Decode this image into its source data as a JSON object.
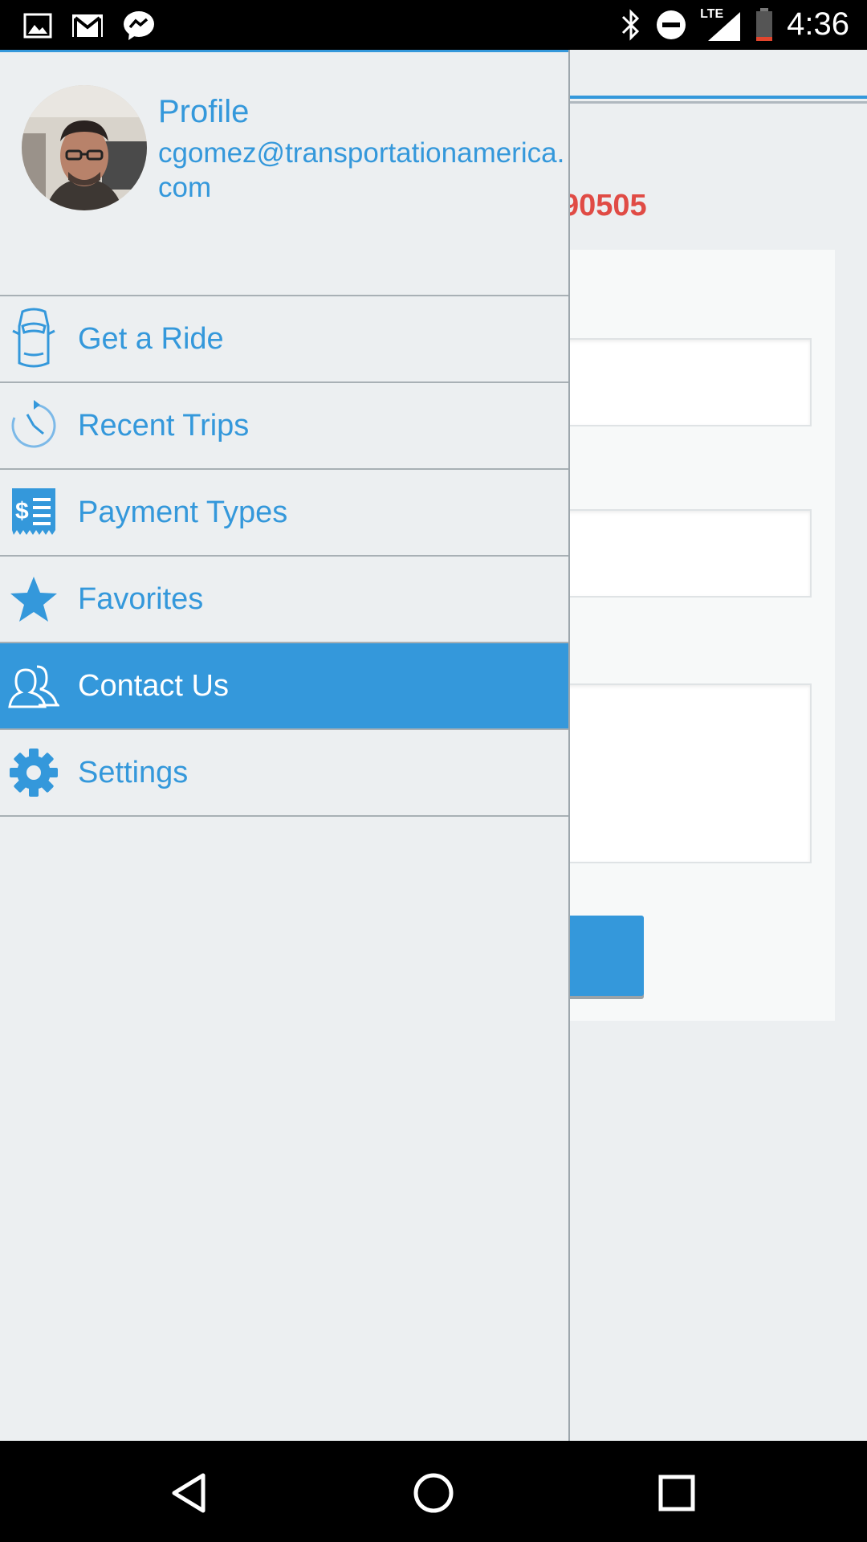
{
  "status_bar": {
    "time": "4:36",
    "network": "LTE",
    "left_icons": [
      "image-icon",
      "gmail-icon",
      "messenger-icon"
    ],
    "right_icons": [
      "bluetooth-icon",
      "do-not-disturb-icon",
      "signal-icon",
      "battery-icon"
    ]
  },
  "background_screen": {
    "code_fragment": "90505",
    "colors": {
      "accent": "#3498db",
      "code": "#e04b45"
    }
  },
  "drawer": {
    "profile": {
      "title": "Profile",
      "email": "cgomez@transportationamerica.com"
    },
    "items": [
      {
        "label": "Get a Ride",
        "icon": "car-icon",
        "active": false
      },
      {
        "label": "Recent Trips",
        "icon": "history-clock-icon",
        "active": false
      },
      {
        "label": "Payment Types",
        "icon": "receipt-dollar-icon",
        "active": false
      },
      {
        "label": "Favorites",
        "icon": "star-icon",
        "active": false
      },
      {
        "label": "Contact Us",
        "icon": "people-icon",
        "active": true
      },
      {
        "label": "Settings",
        "icon": "gear-icon",
        "active": false
      }
    ]
  },
  "nav_bar": {
    "buttons": [
      "back-icon",
      "home-icon",
      "recents-icon"
    ]
  }
}
